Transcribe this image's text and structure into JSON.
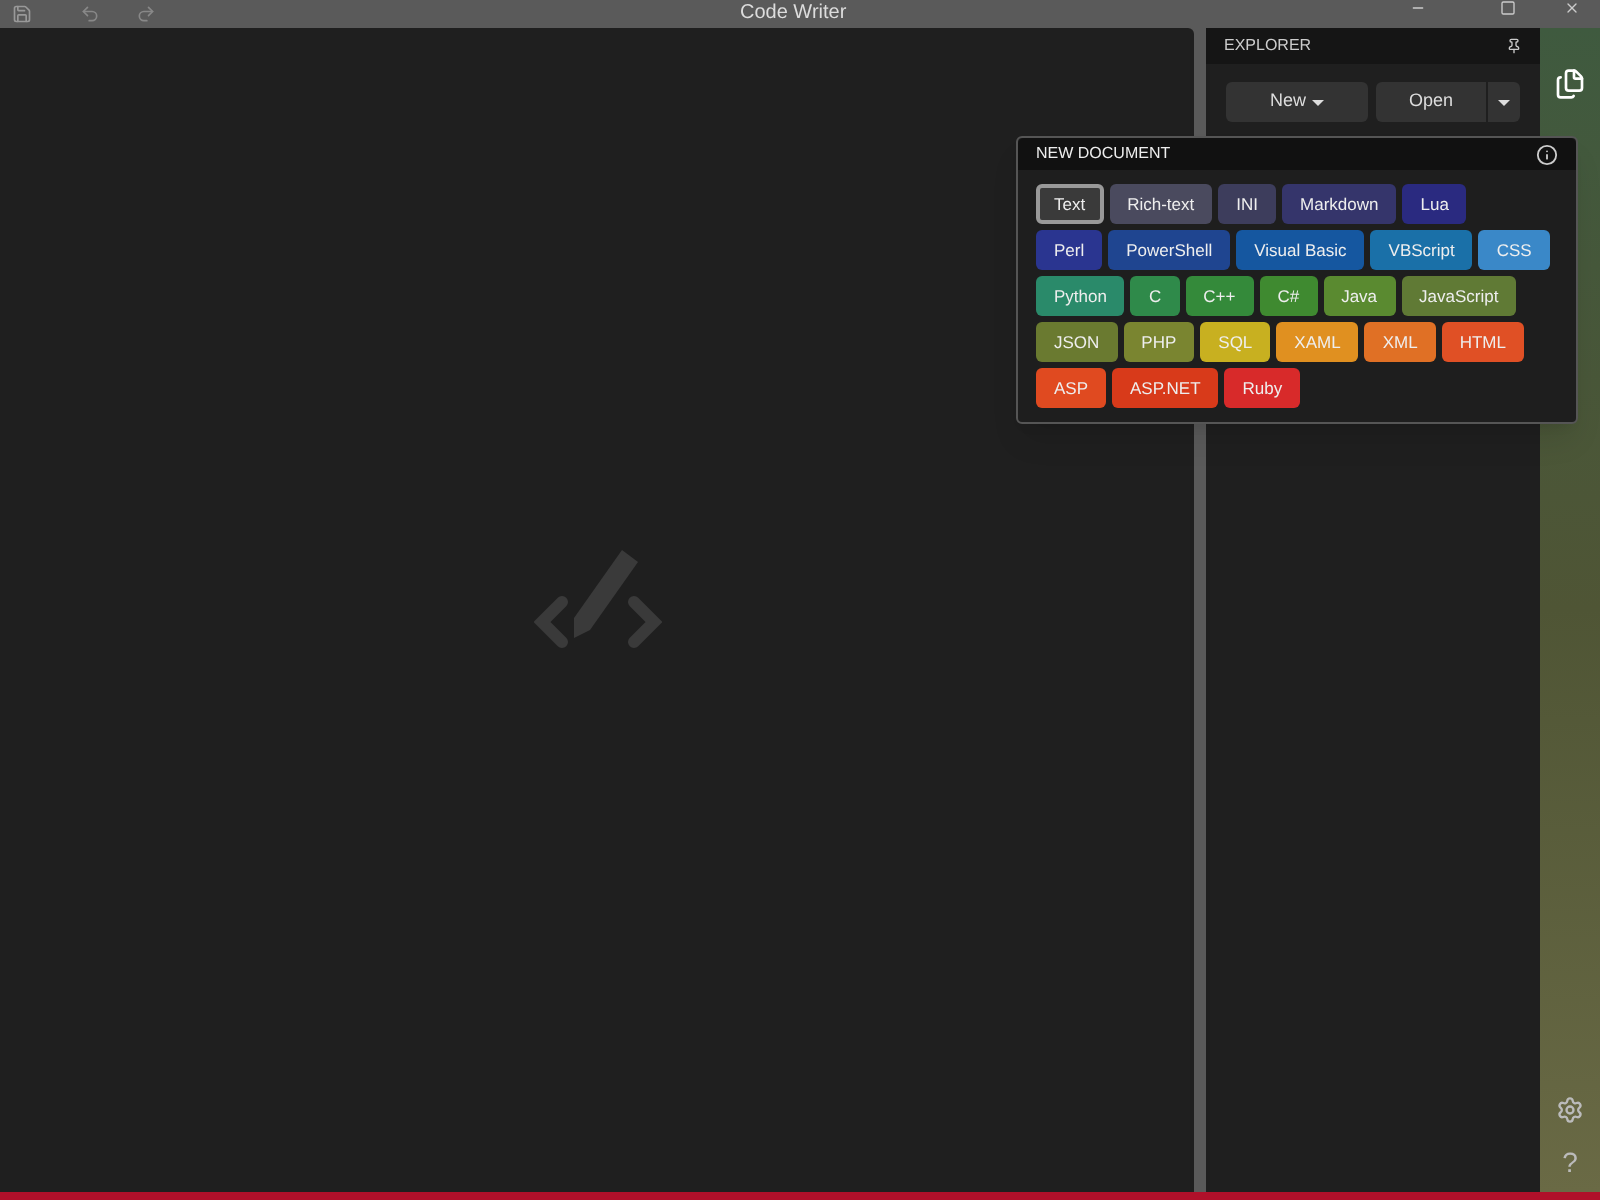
{
  "window": {
    "title": "Code Writer"
  },
  "explorer": {
    "title": "EXPLORER",
    "new_button": "New",
    "open_button": "Open"
  },
  "new_document": {
    "title": "NEW DOCUMENT",
    "types": [
      {
        "label": "Text",
        "color": "#3a3a3a",
        "selected": true
      },
      {
        "label": "Rich-text",
        "color": "#4a4a5e",
        "selected": false
      },
      {
        "label": "INI",
        "color": "#3d3d5c",
        "selected": false
      },
      {
        "label": "Markdown",
        "color": "#35356b",
        "selected": false
      },
      {
        "label": "Lua",
        "color": "#2a2a80",
        "selected": false
      },
      {
        "label": "Perl",
        "color": "#2a3590",
        "selected": false
      },
      {
        "label": "PowerShell",
        "color": "#1f4590",
        "selected": false
      },
      {
        "label": "Visual Basic",
        "color": "#1557a0",
        "selected": false
      },
      {
        "label": "VBScript",
        "color": "#1a70a8",
        "selected": false
      },
      {
        "label": "CSS",
        "color": "#3a88c8",
        "selected": false
      },
      {
        "label": "Python",
        "color": "#2a8a6a",
        "selected": false
      },
      {
        "label": "C",
        "color": "#2f8a4a",
        "selected": false
      },
      {
        "label": "C++",
        "color": "#348a3a",
        "selected": false
      },
      {
        "label": "C#",
        "color": "#3f8a30",
        "selected": false
      },
      {
        "label": "Java",
        "color": "#5a8a30",
        "selected": false
      },
      {
        "label": "JavaScript",
        "color": "#607a35",
        "selected": false
      },
      {
        "label": "JSON",
        "color": "#6a7a30",
        "selected": false
      },
      {
        "label": "PHP",
        "color": "#7a8530",
        "selected": false
      },
      {
        "label": "SQL",
        "color": "#c8b020",
        "selected": false
      },
      {
        "label": "XAML",
        "color": "#e09020",
        "selected": false
      },
      {
        "label": "XML",
        "color": "#e07025",
        "selected": false
      },
      {
        "label": "HTML",
        "color": "#e05025",
        "selected": false
      },
      {
        "label": "ASP",
        "color": "#e04a20",
        "selected": false
      },
      {
        "label": "ASP.NET",
        "color": "#d83a1a",
        "selected": false
      },
      {
        "label": "Ruby",
        "color": "#d82a2a",
        "selected": false
      }
    ]
  },
  "sidebar": {
    "help": "?"
  }
}
